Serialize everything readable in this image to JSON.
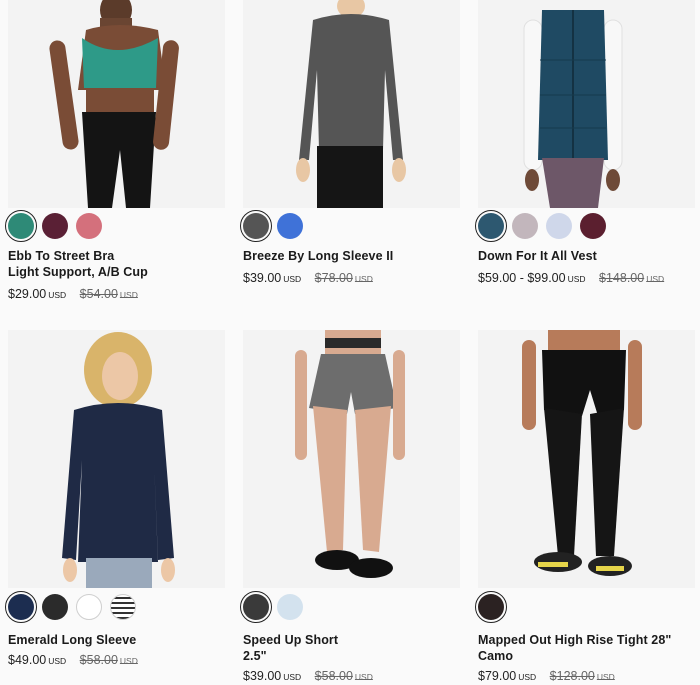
{
  "products": [
    {
      "name_line1": "Ebb To Street Bra",
      "name_line2": "Light Support, A/B Cup",
      "price": "$29.00",
      "currency": "USD",
      "old_price": "$54.00",
      "swatches": [
        "#2e8a77",
        "#5a2035",
        "#d4707c"
      ]
    },
    {
      "name_line1": "Breeze By Long Sleeve II",
      "name_line2": "",
      "price": "$39.00",
      "currency": "USD",
      "old_price": "$78.00",
      "swatches": [
        "#555555",
        "#3f72d8"
      ]
    },
    {
      "name_line1": "Down For It All Vest",
      "name_line2": "",
      "price": "$59.00 - $99.00",
      "currency": "USD",
      "old_price": "$148.00",
      "swatches": [
        "#2d5870",
        "#c2b6bc",
        "#cfd7ea",
        "#5b1f2f"
      ]
    },
    {
      "name_line1": "Emerald Long Sleeve",
      "name_line2": "",
      "price": "$49.00",
      "currency": "USD",
      "old_price": "$58.00",
      "swatches": [
        "#1c2d50",
        "#2b2b2b",
        "#ffffff",
        "#d8d8d8"
      ]
    },
    {
      "name_line1": "Speed Up Short",
      "name_line2": "2.5\"",
      "price": "$39.00",
      "currency": "USD",
      "old_price": "$58.00",
      "swatches": [
        "#3a3a3a",
        "#d3e2ee"
      ]
    },
    {
      "name_line1": "Mapped Out High Rise Tight 28\"",
      "name_line2": "Camo",
      "price": "$79.00",
      "currency": "USD",
      "old_price": "$128.00",
      "swatches": [
        "#2b2222"
      ]
    }
  ]
}
